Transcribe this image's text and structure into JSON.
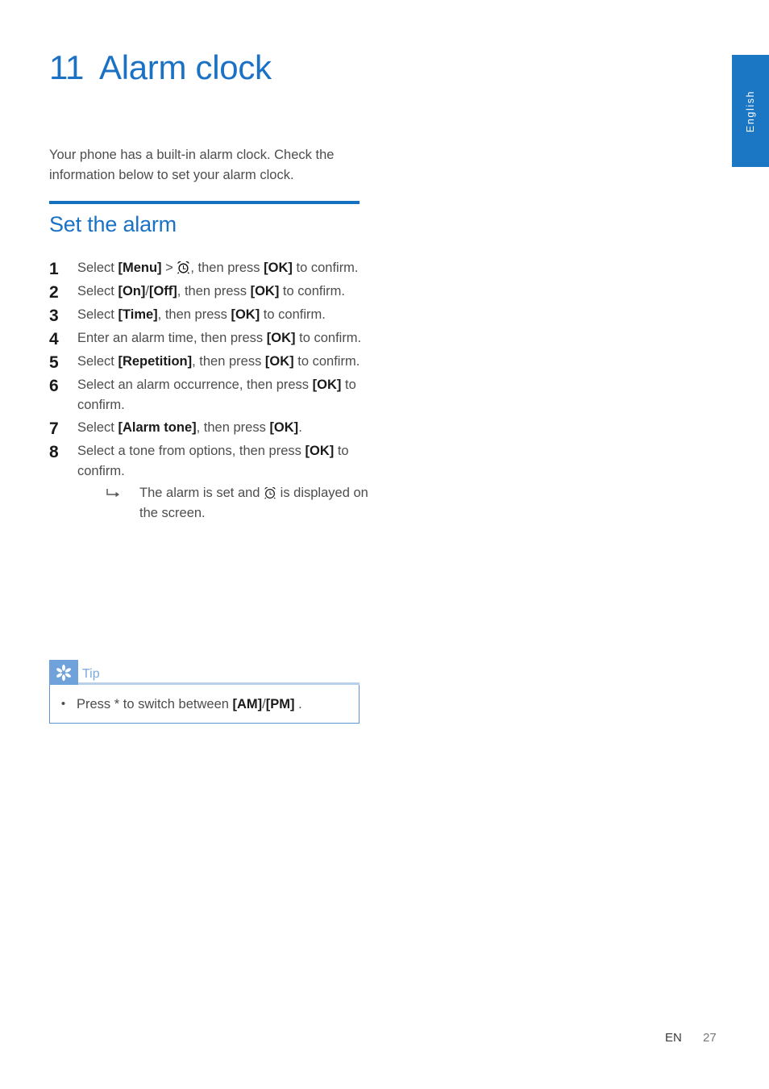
{
  "language_tab": {
    "label": "English"
  },
  "chapter": {
    "number": "11",
    "title": "Alarm clock"
  },
  "intro": "Your phone has a built-in alarm clock. Check the information below to set your alarm clock.",
  "section": {
    "title": "Set the alarm"
  },
  "steps": [
    {
      "num": "1",
      "parts": [
        {
          "t": "Select ",
          "b": false
        },
        {
          "t": "[Menu]",
          "b": true
        },
        {
          "t": " > ",
          "b": false
        },
        {
          "t": "alarm-clock-filled-icon",
          "icon": "alarm-clock-filled"
        },
        {
          "t": ", then press ",
          "b": false
        },
        {
          "t": "[OK]",
          "b": true
        },
        {
          "t": " to confirm.",
          "b": false
        }
      ]
    },
    {
      "num": "2",
      "parts": [
        {
          "t": "Select ",
          "b": false
        },
        {
          "t": "[On]",
          "b": true
        },
        {
          "t": "/",
          "b": false
        },
        {
          "t": "[Off]",
          "b": true
        },
        {
          "t": ", then press ",
          "b": false
        },
        {
          "t": "[OK]",
          "b": true
        },
        {
          "t": " to confirm.",
          "b": false
        }
      ]
    },
    {
      "num": "3",
      "parts": [
        {
          "t": "Select ",
          "b": false
        },
        {
          "t": "[Time]",
          "b": true
        },
        {
          "t": ", then press ",
          "b": false
        },
        {
          "t": "[OK]",
          "b": true
        },
        {
          "t": " to confirm.",
          "b": false
        }
      ]
    },
    {
      "num": "4",
      "parts": [
        {
          "t": "Enter an alarm time, then press ",
          "b": false
        },
        {
          "t": "[OK]",
          "b": true
        },
        {
          "t": " to confirm.",
          "b": false
        }
      ]
    },
    {
      "num": "5",
      "parts": [
        {
          "t": "Select ",
          "b": false
        },
        {
          "t": "[Repetition]",
          "b": true
        },
        {
          "t": ", then press ",
          "b": false
        },
        {
          "t": "[OK]",
          "b": true
        },
        {
          "t": " to confirm.",
          "b": false
        }
      ]
    },
    {
      "num": "6",
      "parts": [
        {
          "t": "Select an alarm occurrence, then press ",
          "b": false
        },
        {
          "t": "[OK]",
          "b": true
        },
        {
          "t": " to confirm.",
          "b": false
        }
      ]
    },
    {
      "num": "7",
      "parts": [
        {
          "t": "Select ",
          "b": false
        },
        {
          "t": "[Alarm tone]",
          "b": true
        },
        {
          "t": ", then press ",
          "b": false
        },
        {
          "t": "[OK]",
          "b": true
        },
        {
          "t": ".",
          "b": false
        }
      ]
    },
    {
      "num": "8",
      "parts": [
        {
          "t": "Select a tone from options, then press ",
          "b": false
        },
        {
          "t": "[OK]",
          "b": true
        },
        {
          "t": " to confirm.",
          "b": false
        }
      ],
      "substep": {
        "hook": "hook-arrow-icon",
        "parts": [
          {
            "t": "The alarm is set and ",
            "b": false
          },
          {
            "t": "alarm-clock-outline-icon",
            "icon": "alarm-clock-outline"
          },
          {
            "t": " is displayed on the screen.",
            "b": false
          }
        ]
      }
    }
  ],
  "tip": {
    "icon": "asterisk-starburst-icon",
    "label": "Tip",
    "bullet": "•",
    "parts": [
      {
        "t": "Press * to switch between ",
        "b": false
      },
      {
        "t": "[AM]",
        "b": true
      },
      {
        "t": "/",
        "b": false
      },
      {
        "t": "[PM]",
        "b": true
      },
      {
        "t": " .",
        "b": false
      }
    ]
  },
  "footer": {
    "lang_code": "EN",
    "page_number": "27"
  },
  "colors": {
    "accent_blue": "#1b72c4",
    "rule_blue": "#1470c0",
    "tab_blue": "#1b76c4",
    "tip_icon_blue": "#6fa2db",
    "tip_label_blue": "#7ba9dd",
    "tip_border_blue": "#5c93d0",
    "body_gray": "#4d4d4d",
    "bold_black": "#1a1a1a"
  }
}
